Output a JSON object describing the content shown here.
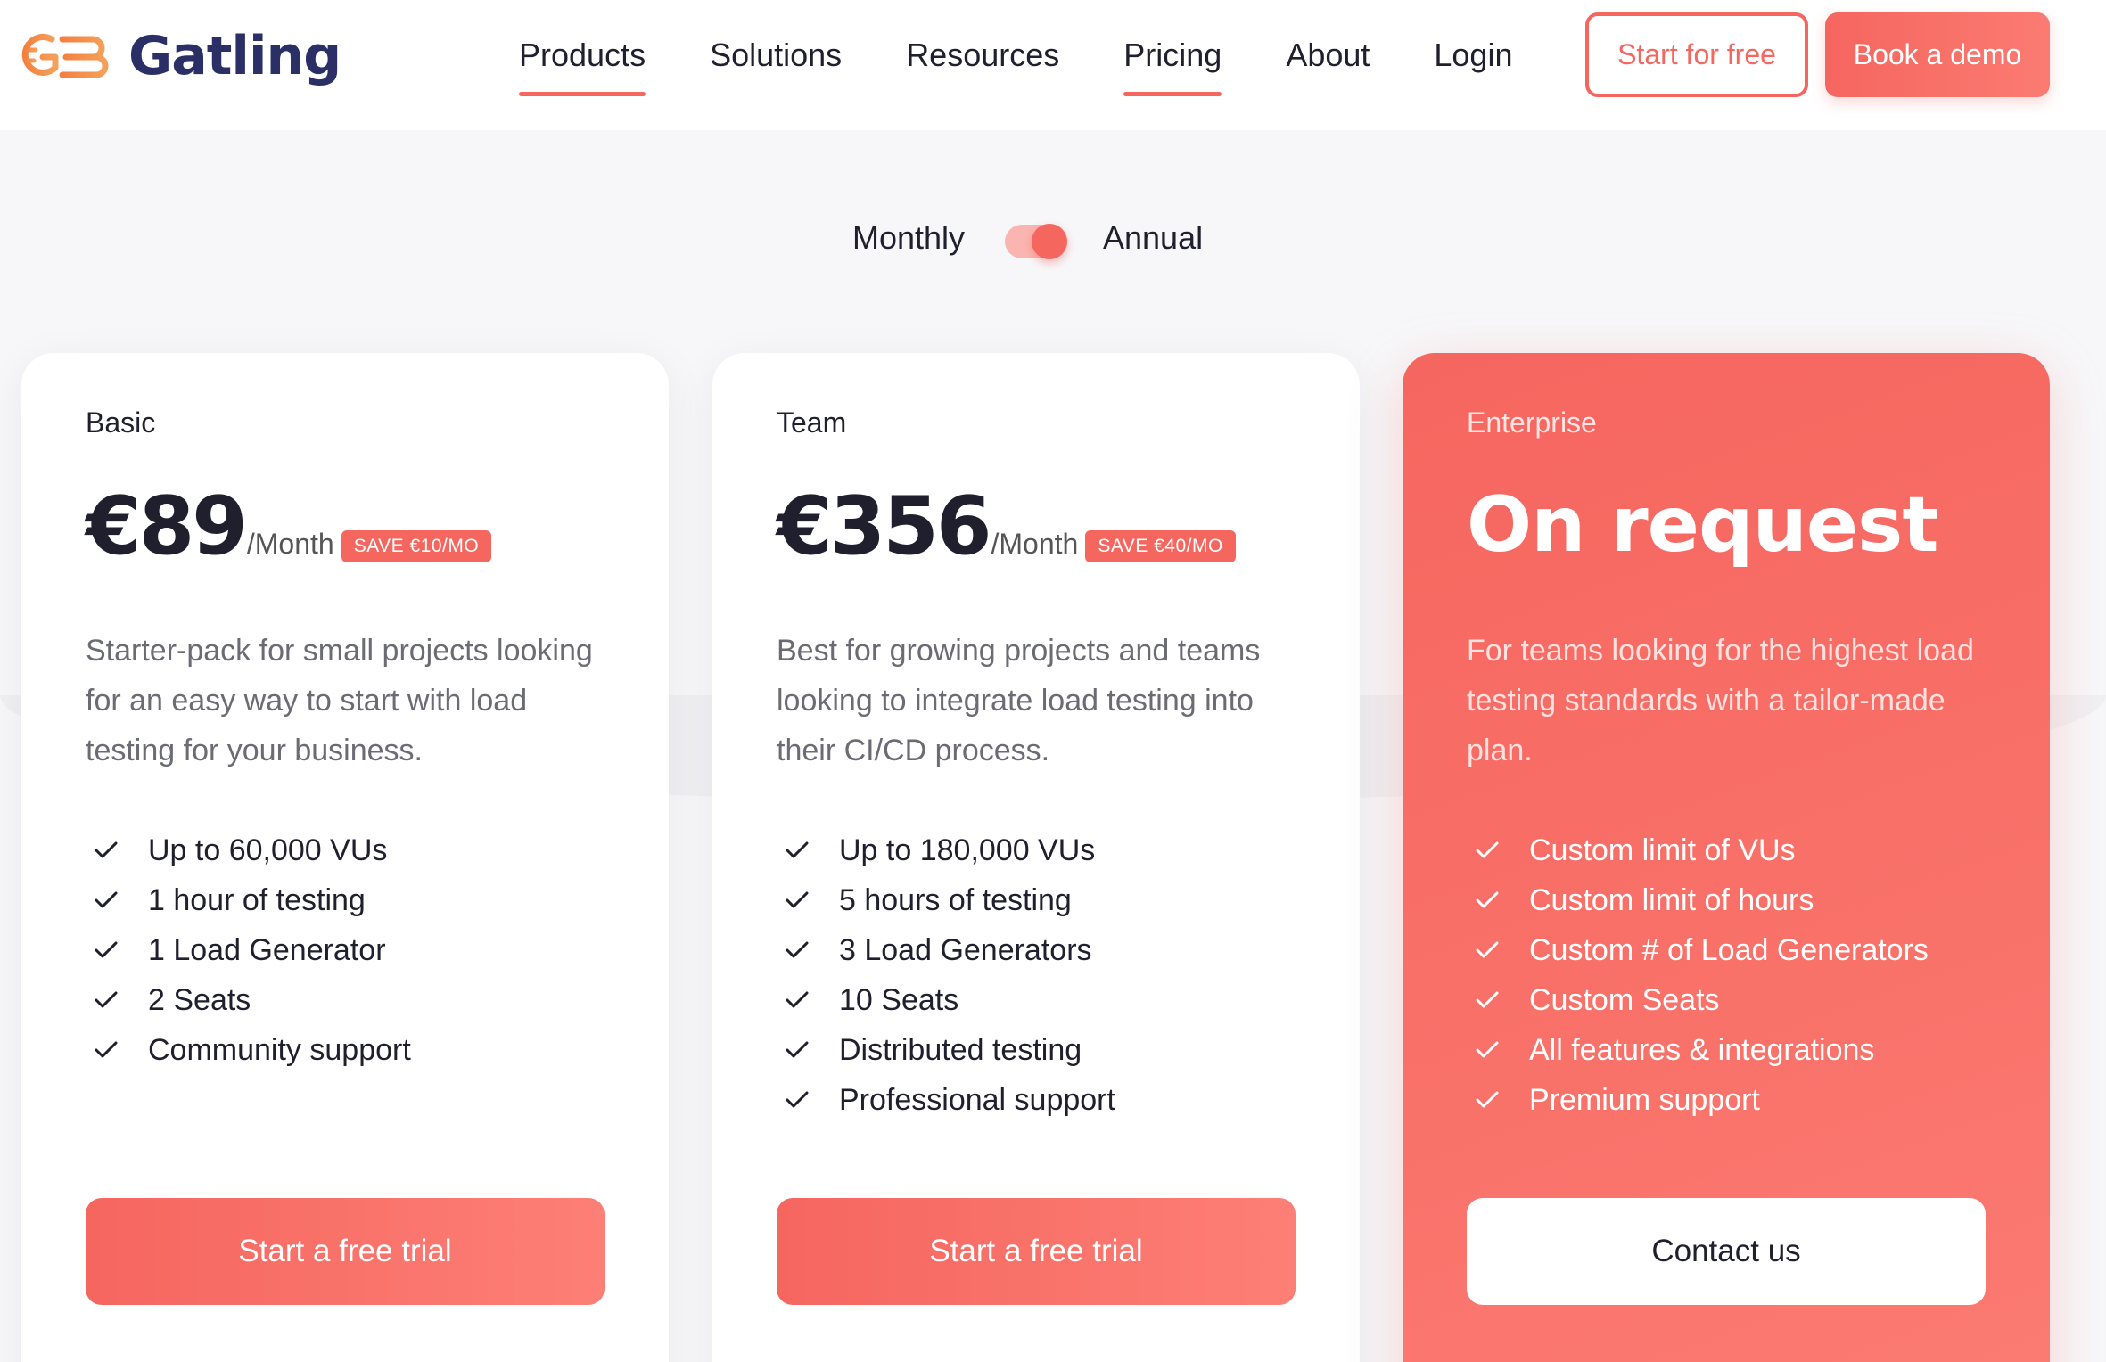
{
  "brand": {
    "name": "Gatling",
    "accent": "#f5665f",
    "dark": "#2a2f66"
  },
  "nav": {
    "items": [
      {
        "label": "Products",
        "active": true
      },
      {
        "label": "Solutions",
        "active": false
      },
      {
        "label": "Resources",
        "active": false
      },
      {
        "label": "Pricing",
        "active": true
      },
      {
        "label": "About",
        "active": false
      },
      {
        "label": "Login",
        "active": false
      }
    ],
    "start_free": "Start for free",
    "book_demo": "Book a demo"
  },
  "billing": {
    "monthly": "Monthly",
    "annual": "Annual",
    "selected": "Annual"
  },
  "plans": [
    {
      "name": "Basic",
      "price": "€89",
      "period": "/Month",
      "save": "SAVE €10/MO",
      "description": "Starter-pack for small projects looking for an easy way to start with load testing for your business.",
      "features": [
        "Up to 60,000 VUs",
        "1 hour of testing",
        "1 Load Generator",
        "2 Seats",
        "Community support"
      ],
      "cta": "Start a free trial"
    },
    {
      "name": "Team",
      "price": "€356",
      "period": "/Month",
      "save": "SAVE €40/MO",
      "description": "Best for growing projects and teams looking to integrate load testing into their CI/CD process.",
      "features": [
        "Up to 180,000 VUs",
        "5 hours of testing",
        "3 Load Generators",
        "10 Seats",
        "Distributed testing",
        "Professional support"
      ],
      "cta": "Start a free trial"
    },
    {
      "name": "Enterprise",
      "price": "On request",
      "description": "For teams looking for the highest load testing standards with a tailor-made plan.",
      "features": [
        "Custom limit of VUs",
        "Custom limit of hours",
        "Custom # of Load Generators",
        "Custom Seats",
        "All features & integrations",
        "Premium support"
      ],
      "cta": "Contact us"
    }
  ],
  "icons": {
    "check": "check-icon",
    "logo": "gatling-logo-icon"
  }
}
